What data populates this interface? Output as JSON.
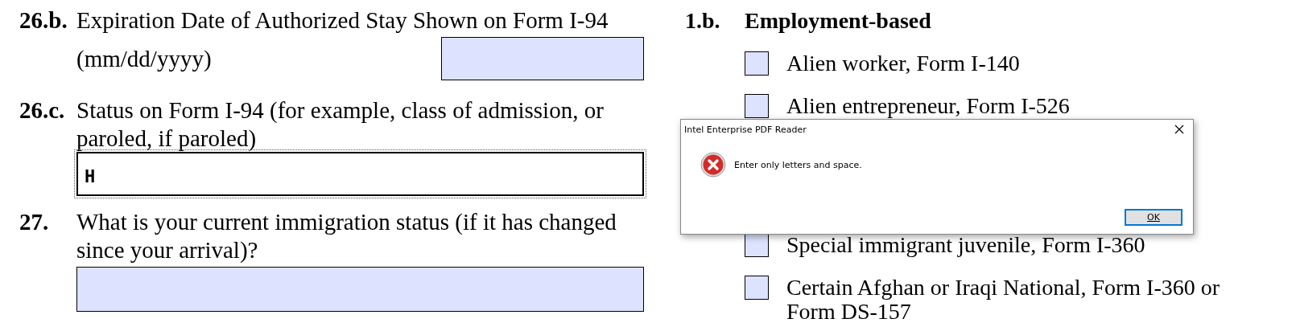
{
  "questions": [
    {
      "number": "26.b.",
      "label": "Expiration Date of Authorized Stay Shown on Form I-94",
      "hint": "(mm/dd/yyyy)",
      "kind": "inline",
      "field": {
        "focused": false
      }
    },
    {
      "number": "26.c.",
      "label": "Status on Form I-94 (for example, class of admission, or paroled, if paroled)",
      "kind": "block",
      "field": {
        "value": "H",
        "focused": true
      }
    },
    {
      "number": "27.",
      "label": "What is your current immigration status (if it has changed since your arrival)?",
      "kind": "block",
      "field": {
        "focused": false
      }
    }
  ],
  "section": {
    "number": "1.b.",
    "title": "Employment-based",
    "options": [
      {
        "label": "Alien worker, Form I-140",
        "checked": false
      },
      {
        "label": "Alien entrepreneur, Form I-526",
        "checked": false
      },
      {
        "label": "Special immigrant juvenile, Form I-360",
        "checked": false
      },
      {
        "label": "Certain Afghan or Iraqi National, Form I-360 or Form DS-157",
        "checked": false
      }
    ]
  },
  "dialog": {
    "title": "Intel Enterprise PDF Reader",
    "message": "Enter only letters and space.",
    "button": "OK"
  }
}
